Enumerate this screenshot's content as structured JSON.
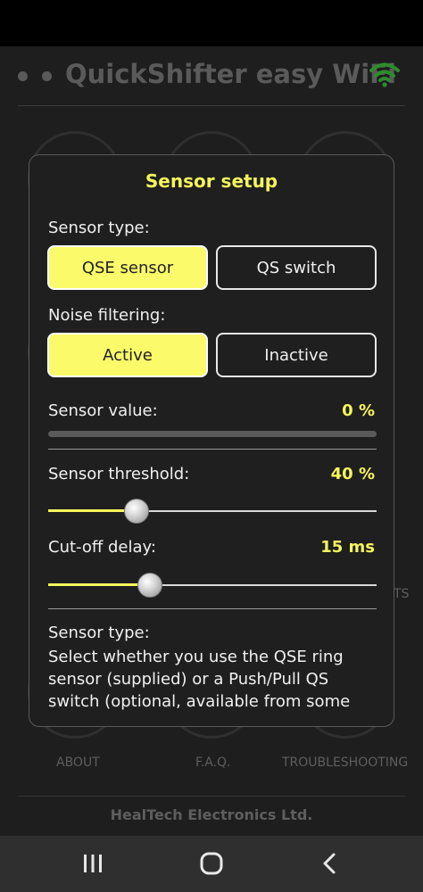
{
  "app": {
    "title": "QuickShifter easy WiFi",
    "footer": "HealTech Electronics Ltd.",
    "background_labels": {
      "about": "ABOUT",
      "faq": "F.A.Q.",
      "troubleshooting": "TROUBLESHOOTING",
      "partial_right": "TS"
    }
  },
  "dialog": {
    "title": "Sensor setup",
    "sensor_type": {
      "label": "Sensor type:",
      "options": [
        "QSE sensor",
        "QS switch"
      ],
      "selected": "QSE sensor"
    },
    "noise_filtering": {
      "label": "Noise filtering:",
      "options": [
        "Active",
        "Inactive"
      ],
      "selected": "Active"
    },
    "sensor_value": {
      "label": "Sensor value:",
      "value_text": "0 %",
      "value": 0
    },
    "sensor_threshold": {
      "label": "Sensor threshold:",
      "value_text": "40 %",
      "value": 0.27
    },
    "cutoff_delay": {
      "label": "Cut-off delay:",
      "value_text": "15 ms",
      "value": 0.31
    },
    "help": {
      "title": "Sensor type:",
      "text": "Select whether you use the QSE ring sensor (supplied) or a Push/Pull QS switch (optional, available from some"
    }
  },
  "colors": {
    "accent": "#f6f65a",
    "dialog_bg": "#1f1f1f",
    "app_bg": "#1e1e1e",
    "wifi": "#2e8b2e"
  },
  "icons": {
    "wifi": "wifi-icon",
    "nav_recents": "recents-icon",
    "nav_home": "home-icon",
    "nav_back": "back-icon"
  }
}
